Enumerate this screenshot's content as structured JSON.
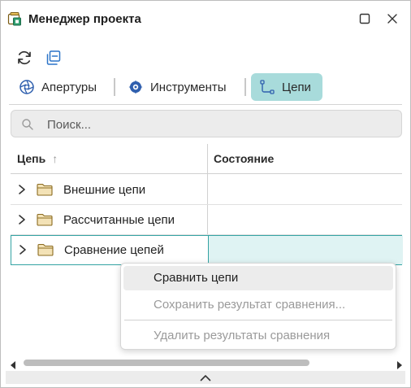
{
  "window": {
    "title": "Менеджер проекта"
  },
  "tabs": [
    {
      "label": "Апертуры",
      "icon": "aperture-icon"
    },
    {
      "label": "Инструменты",
      "icon": "tool-icon"
    },
    {
      "label": "Цепи",
      "icon": "net-icon",
      "active": true
    }
  ],
  "search": {
    "placeholder": "Поиск...",
    "value": ""
  },
  "grid": {
    "columns": [
      {
        "label": "Цепь",
        "sort": "↑"
      },
      {
        "label": "Состояние"
      }
    ],
    "rows": [
      {
        "label": "Внешние цепи",
        "state": ""
      },
      {
        "label": "Рассчитанные цепи",
        "state": ""
      },
      {
        "label": "Сравнение цепей",
        "state": "",
        "selected": true
      }
    ]
  },
  "context_menu": {
    "items": [
      {
        "label": "Сравнить цепи",
        "enabled": true
      },
      {
        "label": "Сохранить результат сравнения...",
        "enabled": false
      },
      {
        "label": "Удалить результаты сравнения",
        "enabled": false
      }
    ]
  },
  "colors": {
    "accent": "#34a3a3",
    "active_tab": "#a8dbdb",
    "selected_row": "#dff3f3",
    "folder": "#f3e2b6"
  }
}
